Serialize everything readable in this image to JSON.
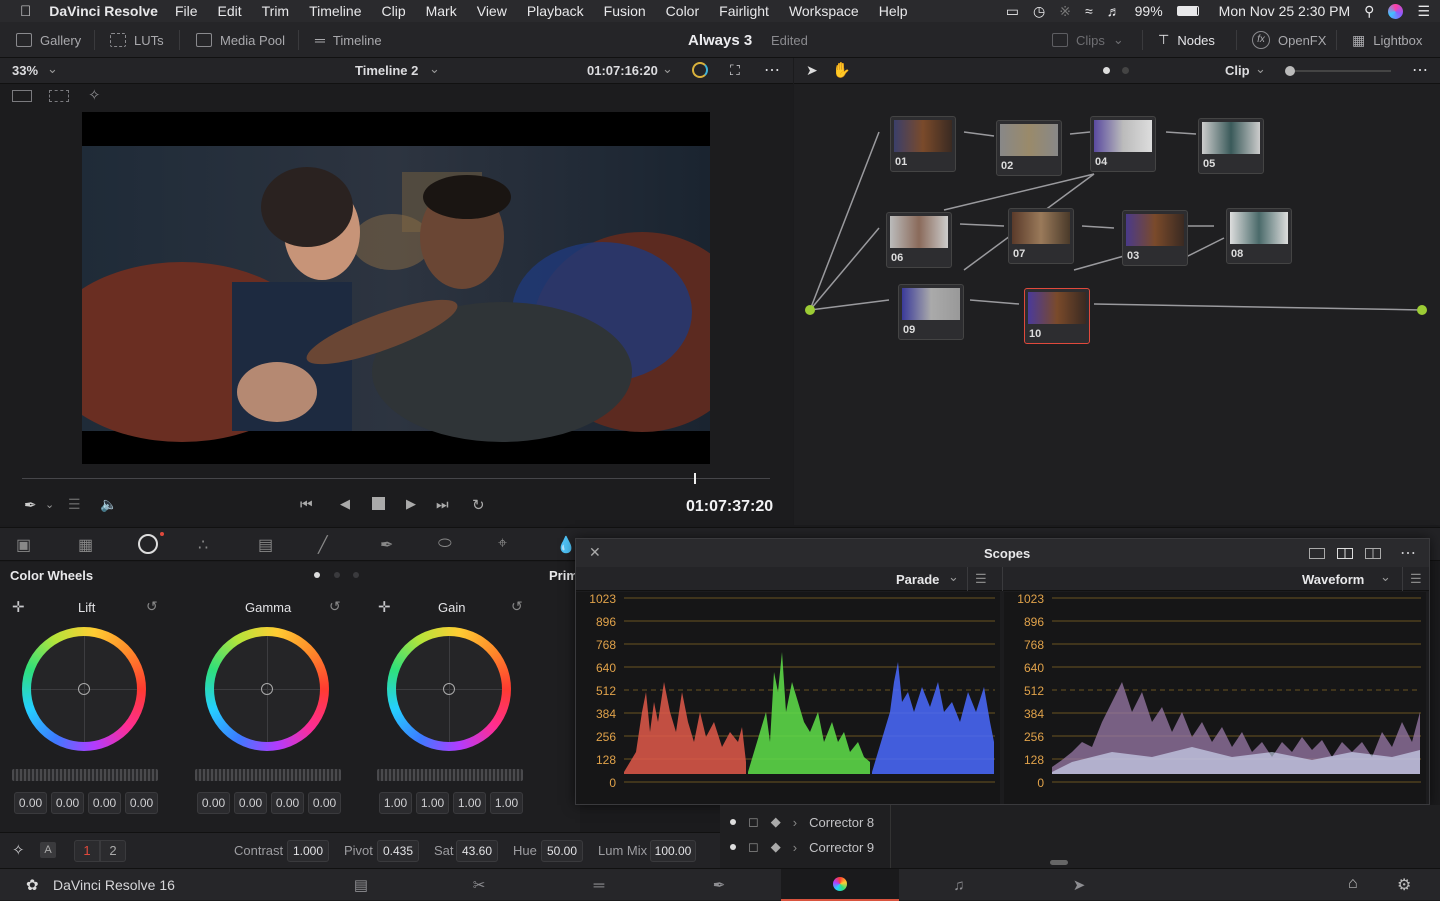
{
  "menubar": {
    "app_name": "DaVinci Resolve",
    "items": [
      "File",
      "Edit",
      "Trim",
      "Timeline",
      "Clip",
      "Mark",
      "View",
      "Playback",
      "Fusion",
      "Color",
      "Fairlight",
      "Workspace",
      "Help"
    ],
    "battery": "99%",
    "clock": "Mon Nov 25  2:30 PM"
  },
  "toolbar": {
    "gallery": "Gallery",
    "luts": "LUTs",
    "media_pool": "Media Pool",
    "timeline": "Timeline",
    "project_title": "Always 3",
    "project_status": "Edited",
    "clips": "Clips",
    "nodes": "Nodes",
    "openfx": "OpenFX",
    "lightbox": "Lightbox"
  },
  "viewer": {
    "zoom": "33%",
    "timeline_name": "Timeline 2",
    "source_timecode": "01:07:16:20",
    "record_timecode": "01:07:37:20",
    "scrub_position": 0.9
  },
  "nodegraph": {
    "mode": "Clip",
    "nodes": [
      {
        "id": "01",
        "selected": false
      },
      {
        "id": "02",
        "selected": false
      },
      {
        "id": "04",
        "selected": false
      },
      {
        "id": "05",
        "selected": false
      },
      {
        "id": "06",
        "selected": false
      },
      {
        "id": "07",
        "selected": false
      },
      {
        "id": "03",
        "selected": false
      },
      {
        "id": "08",
        "selected": false
      },
      {
        "id": "09",
        "selected": false
      },
      {
        "id": "10",
        "selected": true
      }
    ]
  },
  "color_wheels": {
    "panel_title": "Color Wheels",
    "next_panel": "Prim",
    "wheels": [
      {
        "name": "Lift",
        "values": [
          "0.00",
          "0.00",
          "0.00",
          "0.00"
        ]
      },
      {
        "name": "Gamma",
        "values": [
          "0.00",
          "0.00",
          "0.00",
          "0.00"
        ]
      },
      {
        "name": "Gain",
        "values": [
          "1.00",
          "1.00",
          "1.00",
          "1.00"
        ]
      }
    ],
    "page_1": "1",
    "page_2": "2",
    "contrast_label": "Contrast",
    "contrast": "1.000",
    "pivot_label": "Pivot",
    "pivot": "0.435",
    "sat_label": "Sat",
    "sat": "43.60",
    "hue_label": "Hue",
    "hue": "50.00",
    "lummix_label": "Lum Mix",
    "lummix": "100.00"
  },
  "scopes": {
    "title": "Scopes",
    "left_type": "Parade",
    "right_type": "Waveform",
    "ticks": [
      "1023",
      "896",
      "768",
      "640",
      "512",
      "384",
      "256",
      "128",
      "0"
    ]
  },
  "layers": {
    "items": [
      "Corrector 8",
      "Corrector 9"
    ]
  },
  "pagebar": {
    "app_version": "DaVinci Resolve 16",
    "active_page": "color"
  },
  "colors": {
    "accent_red": "#d9533e",
    "tick_orange": "#e0a24a",
    "node_green": "#9ccc35",
    "node_blue": "#2ea8ff"
  }
}
